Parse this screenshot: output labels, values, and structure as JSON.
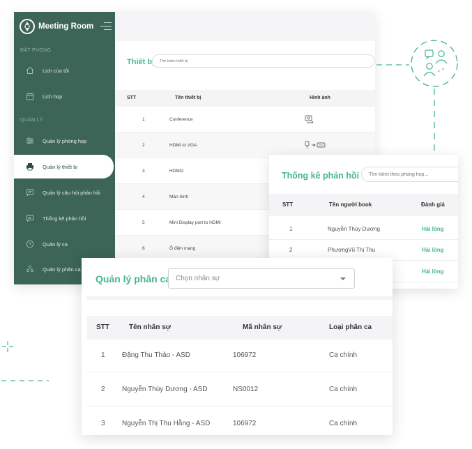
{
  "app": {
    "name": "Meeting Room"
  },
  "sidebar": {
    "section_booking": "ĐẶT PHÒNG",
    "section_manage": "QUẢN LÝ",
    "items": [
      {
        "label": "Lịch của tôi",
        "icon": "home-icon"
      },
      {
        "label": "Lịch họp",
        "icon": "calendar-icon"
      },
      {
        "label": "Quản lý phòng họp",
        "icon": "sliders-icon"
      },
      {
        "label": "Quản lý thiết bị",
        "icon": "printer-icon",
        "active": true
      },
      {
        "label": "Quản lý câu hỏi phản hồi",
        "icon": "chat-icon"
      },
      {
        "label": "Thống kê phản hồi",
        "icon": "chat-icon"
      },
      {
        "label": "Quản lý ca",
        "icon": "clock-icon"
      },
      {
        "label": "Quản lý phân ca",
        "icon": "users-icon"
      }
    ]
  },
  "equipment": {
    "title": "Thiết bị",
    "search_placeholder": "Tìm kiếm thiết bị",
    "columns": [
      "STT",
      "Tên thiết bị",
      "Hình ảnh"
    ],
    "rows": [
      {
        "stt": "1",
        "name": "Conference",
        "icon": "conference-camera-icon"
      },
      {
        "stt": "2",
        "name": "HDMI to VGA",
        "icon": "hdmi-vga-adapter-icon"
      },
      {
        "stt": "3",
        "name": "HDMI2",
        "icon": ""
      },
      {
        "stt": "4",
        "name": "Màn hình",
        "icon": ""
      },
      {
        "stt": "5",
        "name": "Mini Display port to HDMI",
        "icon": ""
      },
      {
        "stt": "6",
        "name": "Ổ điện mạng",
        "icon": ""
      }
    ]
  },
  "feedback": {
    "title": "Thống kê phản hồi",
    "search_placeholder": "Tìm kiếm theo phòng họp...",
    "columns": [
      "STT",
      "Tên người book",
      "Đánh giá"
    ],
    "rows": [
      {
        "stt": "1",
        "name": "Nguyễn Thùy Dương",
        "rating": "Hài lòng"
      },
      {
        "stt": "2",
        "name": "PhươngVũ Thị Thu",
        "rating": "Hài lòng"
      },
      {
        "stt": "",
        "name": "",
        "rating": "Hài lòng"
      }
    ]
  },
  "shifts": {
    "title": "Quản lý phân ca",
    "select_placeholder": "Chọn nhân sự",
    "columns": [
      "STT",
      "Tên nhân sự",
      "Mã nhân sự",
      "Loại phân ca"
    ],
    "rows": [
      {
        "stt": "1",
        "name": "Đặng Thu Thảo - ASD",
        "code": "106972",
        "type": "Ca chính"
      },
      {
        "stt": "2",
        "name": "Nguyễn Thùy Dương - ASD",
        "code": "NS0012",
        "type": "Ca chính"
      },
      {
        "stt": "3",
        "name": "Nguyễn Thị Thu Hằng - ASD",
        "code": "106972",
        "type": "Ca chính"
      }
    ]
  },
  "colors": {
    "sidebar_bg": "#3c6457",
    "accent_green": "#47b596",
    "table_head_bg": "#f4f4f6"
  }
}
